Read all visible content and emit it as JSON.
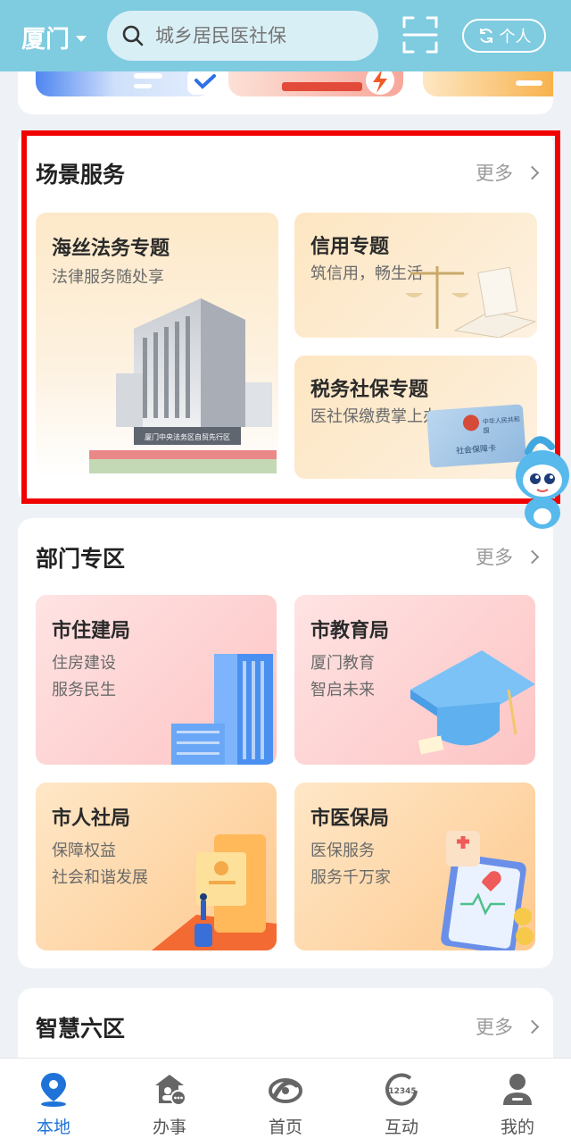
{
  "header": {
    "city": "厦门",
    "search_placeholder": "城乡居民医社保",
    "mode_label": "个人"
  },
  "scene_services": {
    "title": "场景服务",
    "more": "更多",
    "cards": [
      {
        "title": "海丝法务专题",
        "subtitle": "法律服务随处享"
      },
      {
        "title": "信用专题",
        "subtitle": "筑信用，畅生活"
      },
      {
        "title": "税务社保专题",
        "subtitle": "医社保缴费掌上办"
      }
    ],
    "building_sign": "厦门中央法务区自贸先行区",
    "card_text": "社会保障卡",
    "card_issuer": "中华人民共和国"
  },
  "departments": {
    "title": "部门专区",
    "more": "更多",
    "cards": [
      {
        "title": "市住建局",
        "line1": "住房建设",
        "line2": "服务民生"
      },
      {
        "title": "市教育局",
        "line1": "厦门教育",
        "line2": "智启未来"
      },
      {
        "title": "市人社局",
        "line1": "保障权益",
        "line2": "社会和谐发展"
      },
      {
        "title": "市医保局",
        "line1": "医保服务",
        "line2": "服务千万家"
      }
    ]
  },
  "six_districts": {
    "title": "智慧六区",
    "more": "更多"
  },
  "tabs": [
    {
      "label": "本地",
      "icon": "location-pin-icon",
      "active": true
    },
    {
      "label": "办事",
      "icon": "service-hall-icon",
      "active": false
    },
    {
      "label": "首页",
      "icon": "home-logo-icon",
      "active": false
    },
    {
      "label": "互动",
      "icon": "hotline-12345-icon",
      "active": false
    },
    {
      "label": "我的",
      "icon": "user-icon",
      "active": false
    }
  ],
  "hotline": "12345",
  "colors": {
    "header": "#7fcbe0",
    "accent": "#1f73d8",
    "highlight": "#f00200"
  }
}
